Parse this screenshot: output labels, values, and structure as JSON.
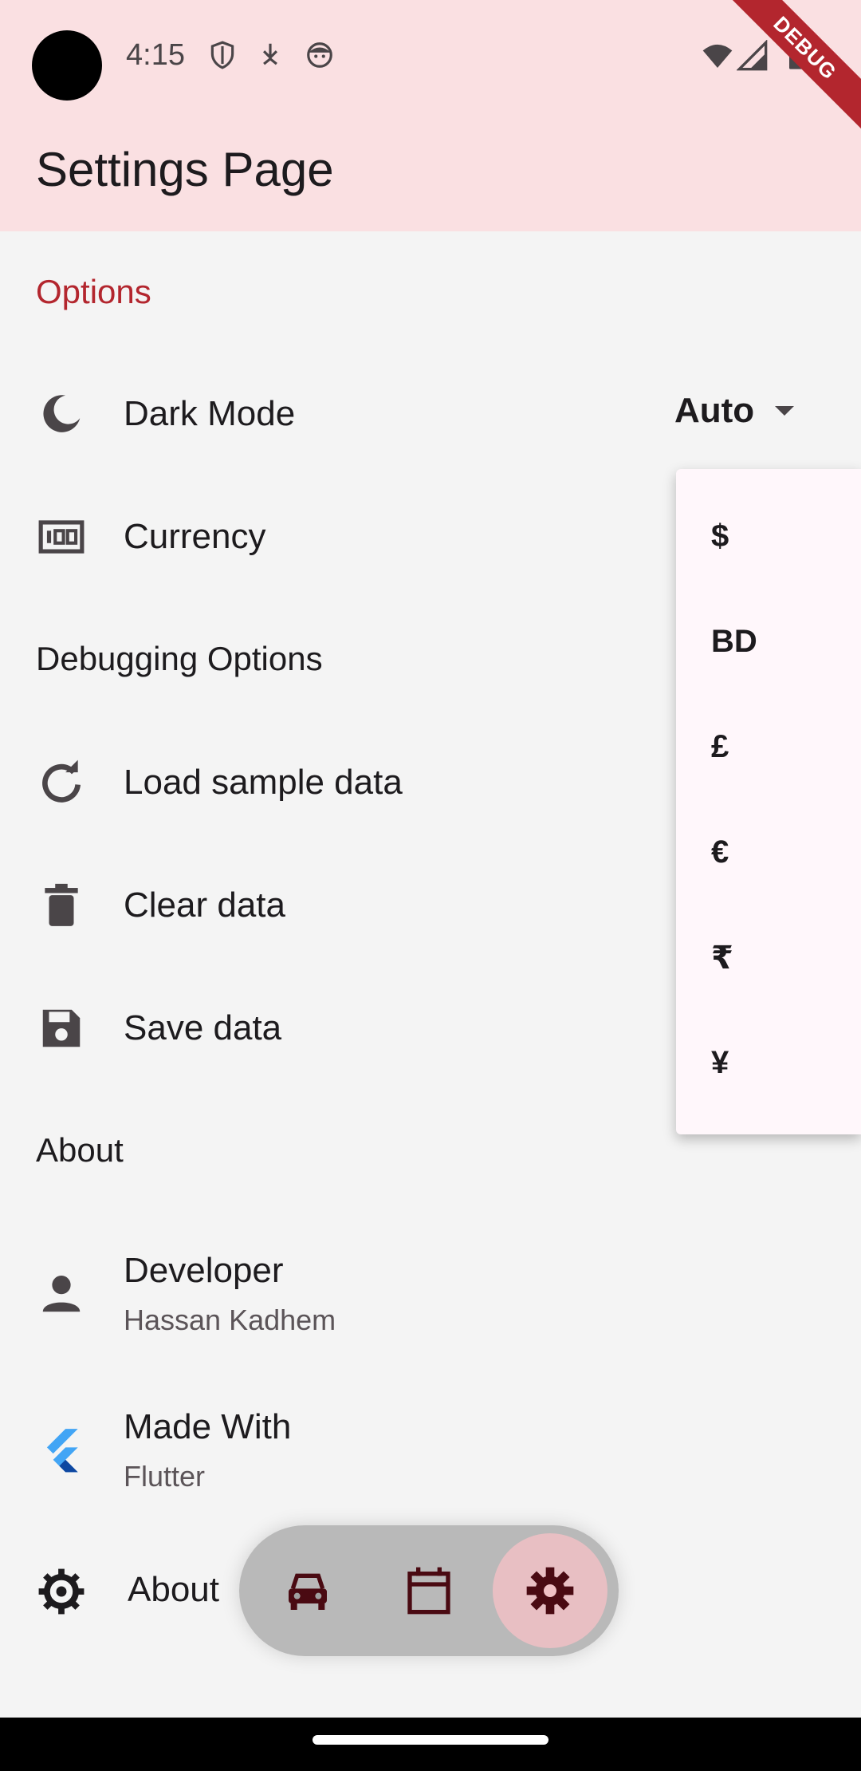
{
  "status_bar": {
    "time": "4:15"
  },
  "app_bar": {
    "title": "Settings Page",
    "debug_banner": "DEBUG"
  },
  "sections": {
    "options": "Options",
    "debugging": "Debugging Options",
    "about": "About"
  },
  "rows": {
    "dark_mode": {
      "label": "Dark Mode",
      "value": "Auto"
    },
    "currency": {
      "label": "Currency"
    },
    "load_sample": {
      "label": "Load sample data"
    },
    "clear_data": {
      "label": "Clear data"
    },
    "save_data": {
      "label": "Save data"
    },
    "developer": {
      "label": "Developer",
      "subtitle": "Hassan Kadhem"
    },
    "made_with": {
      "label": "Made With",
      "subtitle": "Flutter"
    },
    "about_app": {
      "label": "About"
    }
  },
  "currency_menu": {
    "items": [
      "$",
      "BD",
      "£",
      "€",
      "₹",
      "¥"
    ]
  },
  "colors": {
    "accent": "#b3262e",
    "header_bg": "#fae0e2",
    "page_bg": "#f4f4f4",
    "menu_bg": "#fff7fb",
    "nav_icon": "#4a0a12"
  }
}
